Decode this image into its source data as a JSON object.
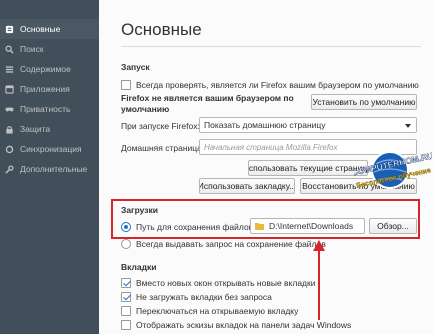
{
  "sidebar": {
    "items": [
      {
        "label": "Основные",
        "icon": "general-icon",
        "active": true
      },
      {
        "label": "Поиск",
        "icon": "search-icon",
        "active": false
      },
      {
        "label": "Содержимое",
        "icon": "content-icon",
        "active": false
      },
      {
        "label": "Приложения",
        "icon": "applications-icon",
        "active": false
      },
      {
        "label": "Приватность",
        "icon": "privacy-mask-icon",
        "active": false
      },
      {
        "label": "Защита",
        "icon": "security-lock-icon",
        "active": false
      },
      {
        "label": "Синхронизация",
        "icon": "sync-icon",
        "active": false
      },
      {
        "label": "Дополнительные",
        "icon": "advanced-icon",
        "active": false
      }
    ]
  },
  "main": {
    "title": "Основные",
    "startup": {
      "heading": "Запуск",
      "default_check_label": "Всегда проверять, является ли Firefox вашим браузером по умолчанию",
      "default_check_checked": false,
      "not_default_line1": "Firefox не является вашим браузером по",
      "not_default_line2": "умолчанию",
      "set_default_button": "Установить по умолчанию",
      "on_start_label": "При запуске Firefox:",
      "on_start_value": "Показать домашнюю страницу",
      "homepage_label": "Домашняя страница:",
      "homepage_placeholder": "Начальная страница Mozilla Firefox",
      "use_current_button": "Использовать текущие страницы",
      "use_bookmark_button": "Использовать закладку...",
      "restore_default_button": "Восстановить по умолчанию"
    },
    "downloads": {
      "heading": "Загрузки",
      "save_path_label": "Путь для сохранения файлов",
      "save_path_selected": true,
      "folder_path": "D:\\Internet\\Downloads",
      "browse_button": "Обзор...",
      "always_ask_label": "Всегда выдавать запрос на сохранение файлов",
      "always_ask_selected": false
    },
    "tabs": {
      "heading": "Вкладки",
      "items": [
        {
          "label": "Вместо новых окон открывать новые вкладки",
          "checked": true
        },
        {
          "label": "Не загружать вкладки без запроса",
          "checked": true
        },
        {
          "label": "Переключаться на открываемую вкладку",
          "checked": false
        },
        {
          "label": "Отображать эскизы вкладок на панели задач Windows",
          "checked": false
        }
      ]
    }
  },
  "watermark": {
    "line1": "COMPUTERHOM.RU",
    "line2": "Бесплатное обучение"
  },
  "colors": {
    "sidebar_bg": "#424f5a",
    "sidebar_active_bg": "#4a5863",
    "accent_blue": "#1d73cc",
    "highlight_red": "#d9252a"
  }
}
